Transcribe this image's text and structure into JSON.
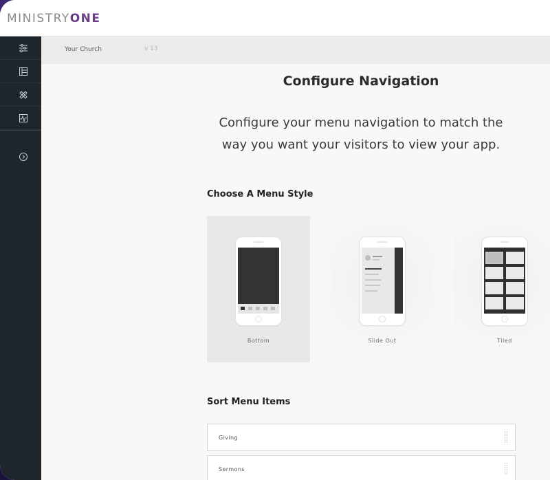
{
  "app": {
    "logo_light": "MINISTRY",
    "logo_bold": "ONE",
    "brand_color": "#6a3d8a"
  },
  "sidebar": {
    "items": [
      {
        "icon": "sliders-icon"
      },
      {
        "icon": "list-layout-icon"
      },
      {
        "icon": "tools-icon"
      },
      {
        "icon": "activity-chart-icon"
      },
      {
        "icon": "circle-arrow-right-icon"
      }
    ]
  },
  "breadcrumb": {
    "church": "Your Church",
    "version": "v 13"
  },
  "page": {
    "title": "Configure Navigation",
    "subtitle_line1": "Configure your menu navigation to match the",
    "subtitle_line2": "way you want your visitors to view your app."
  },
  "menu_style": {
    "heading": "Choose A Menu Style",
    "selected": "Bottom",
    "options": [
      {
        "label": "Bottom",
        "selected": true
      },
      {
        "label": "Slide Out",
        "selected": false
      },
      {
        "label": "Tiled",
        "selected": false
      }
    ]
  },
  "sort_menu": {
    "heading": "Sort Menu Items",
    "items": [
      {
        "label": "Giving"
      },
      {
        "label": "Sermons"
      }
    ]
  }
}
